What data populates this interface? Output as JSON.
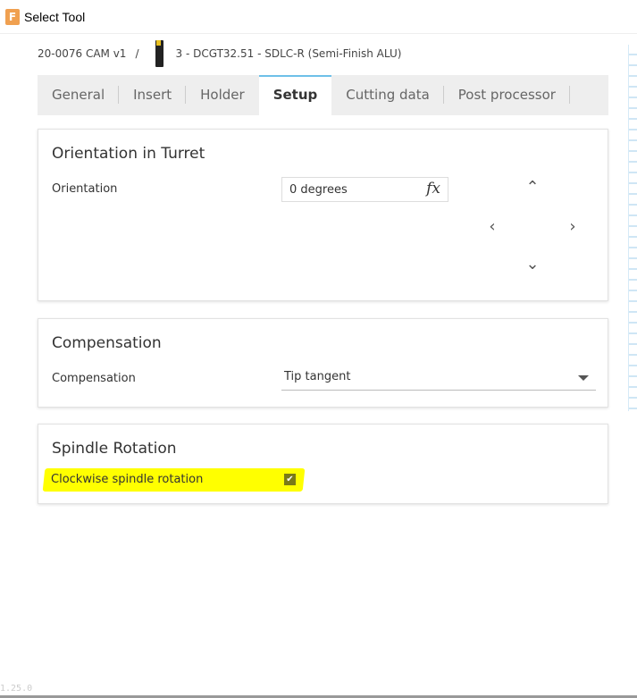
{
  "window": {
    "title": "Select Tool",
    "icon_letter": "F"
  },
  "breadcrumb": {
    "document": "20-0076 CAM v1",
    "separator": "/",
    "tool": "3 - DCGT32.51 - SDLC-R (Semi-Finish ALU)"
  },
  "tabs": [
    {
      "label": "General"
    },
    {
      "label": "Insert"
    },
    {
      "label": "Holder"
    },
    {
      "label": "Setup",
      "active": true
    },
    {
      "label": "Cutting data"
    },
    {
      "label": "Post processor"
    }
  ],
  "orientation": {
    "heading": "Orientation in Turret",
    "label": "Orientation",
    "value": "0 degrees",
    "fx": "fx"
  },
  "compensation": {
    "heading": "Compensation",
    "label": "Compensation",
    "value": "Tip tangent"
  },
  "spindle": {
    "heading": "Spindle Rotation",
    "label": "Clockwise spindle rotation",
    "checked": true,
    "check": "✔"
  },
  "version": "1.25.0"
}
